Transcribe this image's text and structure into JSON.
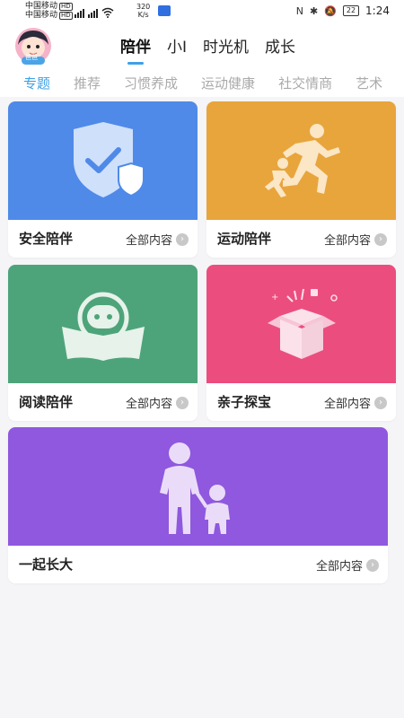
{
  "status": {
    "carrier1": "中国移动",
    "carrier2": "中国移动",
    "hd": "HD",
    "net": "4G",
    "speed_val": "320",
    "speed_unit": "K/s",
    "battery": "22",
    "time": "1:24"
  },
  "avatar": {
    "label": "爸爸"
  },
  "top_tabs": [
    "陪伴",
    "小I",
    "时光机",
    "成长"
  ],
  "sub_tabs": [
    "专题",
    "推荐",
    "习惯养成",
    "运动健康",
    "社交情商",
    "艺术"
  ],
  "more_label": "全部内容",
  "cards": [
    {
      "title": "安全陪伴",
      "color": "#4f8ae8",
      "icon": "shield-check-icon"
    },
    {
      "title": "运动陪伴",
      "color": "#e8a53c",
      "icon": "running-people-icon"
    },
    {
      "title": "阅读陪伴",
      "color": "#4ea47a",
      "icon": "robot-reading-icon"
    },
    {
      "title": "亲子探宝",
      "color": "#ec4d7f",
      "icon": "gift-box-icon"
    },
    {
      "title": "一起长大",
      "color": "#8f58de",
      "icon": "parent-child-icon"
    }
  ]
}
